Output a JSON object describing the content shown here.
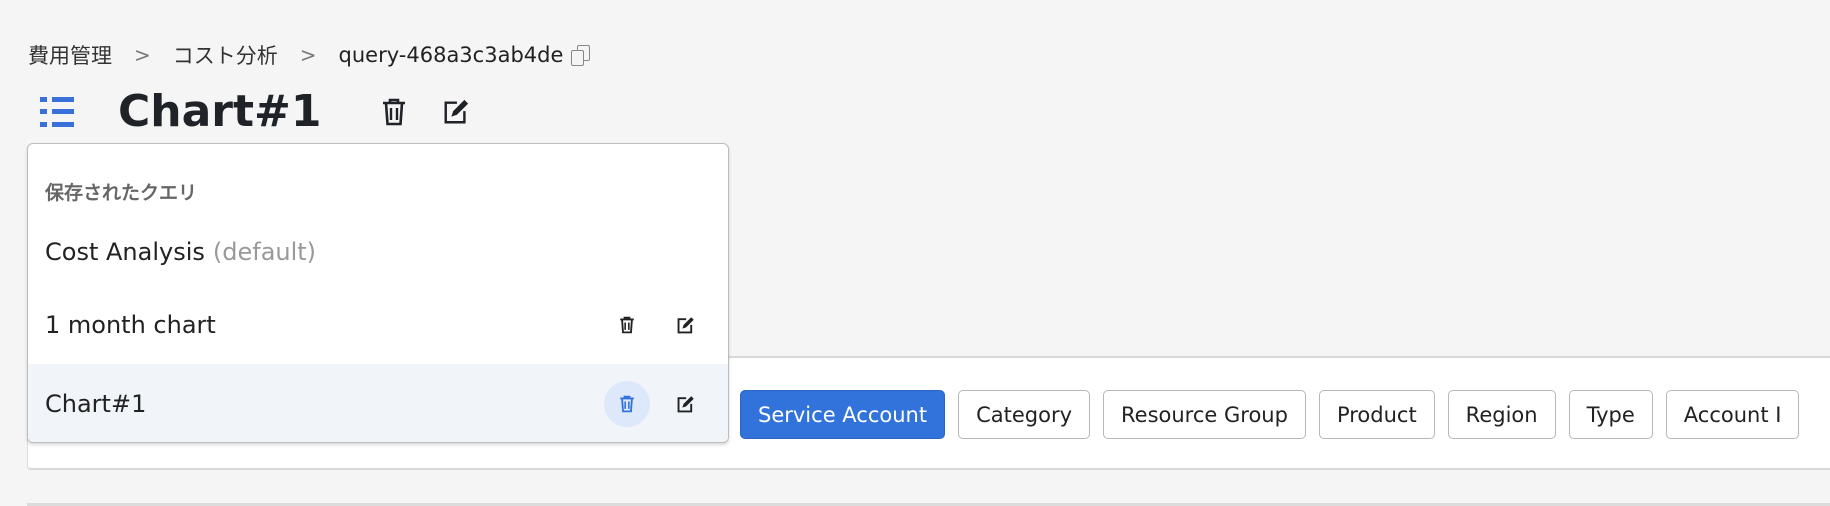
{
  "breadcrumb": {
    "items": [
      "費用管理",
      "コスト分析"
    ],
    "current": "query-468a3c3ab4de",
    "separator": ">"
  },
  "header": {
    "title": "Chart#1"
  },
  "dropdown": {
    "heading": "保存されたクエリ",
    "items": [
      {
        "label": "Cost Analysis",
        "suffix": "(default)"
      },
      {
        "label": "1 month chart"
      },
      {
        "label": "Chart#1",
        "selected": true
      }
    ]
  },
  "group_by": {
    "options": [
      "Service Account",
      "Category",
      "Resource Group",
      "Product",
      "Region",
      "Type",
      "Account I"
    ],
    "active": "Service Account"
  },
  "colors": {
    "accent": "#3173db",
    "selected_row": "#f1f4f9"
  }
}
